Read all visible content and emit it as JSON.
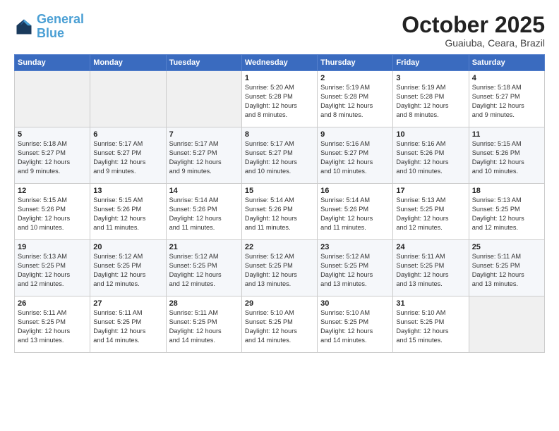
{
  "header": {
    "logo_line1": "General",
    "logo_line2": "Blue",
    "month": "October 2025",
    "location": "Guaiuba, Ceara, Brazil"
  },
  "weekdays": [
    "Sunday",
    "Monday",
    "Tuesday",
    "Wednesday",
    "Thursday",
    "Friday",
    "Saturday"
  ],
  "weeks": [
    [
      {
        "day": "",
        "info": ""
      },
      {
        "day": "",
        "info": ""
      },
      {
        "day": "",
        "info": ""
      },
      {
        "day": "1",
        "info": "Sunrise: 5:20 AM\nSunset: 5:28 PM\nDaylight: 12 hours\nand 8 minutes."
      },
      {
        "day": "2",
        "info": "Sunrise: 5:19 AM\nSunset: 5:28 PM\nDaylight: 12 hours\nand 8 minutes."
      },
      {
        "day": "3",
        "info": "Sunrise: 5:19 AM\nSunset: 5:28 PM\nDaylight: 12 hours\nand 8 minutes."
      },
      {
        "day": "4",
        "info": "Sunrise: 5:18 AM\nSunset: 5:27 PM\nDaylight: 12 hours\nand 9 minutes."
      }
    ],
    [
      {
        "day": "5",
        "info": "Sunrise: 5:18 AM\nSunset: 5:27 PM\nDaylight: 12 hours\nand 9 minutes."
      },
      {
        "day": "6",
        "info": "Sunrise: 5:17 AM\nSunset: 5:27 PM\nDaylight: 12 hours\nand 9 minutes."
      },
      {
        "day": "7",
        "info": "Sunrise: 5:17 AM\nSunset: 5:27 PM\nDaylight: 12 hours\nand 9 minutes."
      },
      {
        "day": "8",
        "info": "Sunrise: 5:17 AM\nSunset: 5:27 PM\nDaylight: 12 hours\nand 10 minutes."
      },
      {
        "day": "9",
        "info": "Sunrise: 5:16 AM\nSunset: 5:27 PM\nDaylight: 12 hours\nand 10 minutes."
      },
      {
        "day": "10",
        "info": "Sunrise: 5:16 AM\nSunset: 5:26 PM\nDaylight: 12 hours\nand 10 minutes."
      },
      {
        "day": "11",
        "info": "Sunrise: 5:15 AM\nSunset: 5:26 PM\nDaylight: 12 hours\nand 10 minutes."
      }
    ],
    [
      {
        "day": "12",
        "info": "Sunrise: 5:15 AM\nSunset: 5:26 PM\nDaylight: 12 hours\nand 10 minutes."
      },
      {
        "day": "13",
        "info": "Sunrise: 5:15 AM\nSunset: 5:26 PM\nDaylight: 12 hours\nand 11 minutes."
      },
      {
        "day": "14",
        "info": "Sunrise: 5:14 AM\nSunset: 5:26 PM\nDaylight: 12 hours\nand 11 minutes."
      },
      {
        "day": "15",
        "info": "Sunrise: 5:14 AM\nSunset: 5:26 PM\nDaylight: 12 hours\nand 11 minutes."
      },
      {
        "day": "16",
        "info": "Sunrise: 5:14 AM\nSunset: 5:26 PM\nDaylight: 12 hours\nand 11 minutes."
      },
      {
        "day": "17",
        "info": "Sunrise: 5:13 AM\nSunset: 5:25 PM\nDaylight: 12 hours\nand 12 minutes."
      },
      {
        "day": "18",
        "info": "Sunrise: 5:13 AM\nSunset: 5:25 PM\nDaylight: 12 hours\nand 12 minutes."
      }
    ],
    [
      {
        "day": "19",
        "info": "Sunrise: 5:13 AM\nSunset: 5:25 PM\nDaylight: 12 hours\nand 12 minutes."
      },
      {
        "day": "20",
        "info": "Sunrise: 5:12 AM\nSunset: 5:25 PM\nDaylight: 12 hours\nand 12 minutes."
      },
      {
        "day": "21",
        "info": "Sunrise: 5:12 AM\nSunset: 5:25 PM\nDaylight: 12 hours\nand 12 minutes."
      },
      {
        "day": "22",
        "info": "Sunrise: 5:12 AM\nSunset: 5:25 PM\nDaylight: 12 hours\nand 13 minutes."
      },
      {
        "day": "23",
        "info": "Sunrise: 5:12 AM\nSunset: 5:25 PM\nDaylight: 12 hours\nand 13 minutes."
      },
      {
        "day": "24",
        "info": "Sunrise: 5:11 AM\nSunset: 5:25 PM\nDaylight: 12 hours\nand 13 minutes."
      },
      {
        "day": "25",
        "info": "Sunrise: 5:11 AM\nSunset: 5:25 PM\nDaylight: 12 hours\nand 13 minutes."
      }
    ],
    [
      {
        "day": "26",
        "info": "Sunrise: 5:11 AM\nSunset: 5:25 PM\nDaylight: 12 hours\nand 13 minutes."
      },
      {
        "day": "27",
        "info": "Sunrise: 5:11 AM\nSunset: 5:25 PM\nDaylight: 12 hours\nand 14 minutes."
      },
      {
        "day": "28",
        "info": "Sunrise: 5:11 AM\nSunset: 5:25 PM\nDaylight: 12 hours\nand 14 minutes."
      },
      {
        "day": "29",
        "info": "Sunrise: 5:10 AM\nSunset: 5:25 PM\nDaylight: 12 hours\nand 14 minutes."
      },
      {
        "day": "30",
        "info": "Sunrise: 5:10 AM\nSunset: 5:25 PM\nDaylight: 12 hours\nand 14 minutes."
      },
      {
        "day": "31",
        "info": "Sunrise: 5:10 AM\nSunset: 5:25 PM\nDaylight: 12 hours\nand 15 minutes."
      },
      {
        "day": "",
        "info": ""
      }
    ]
  ]
}
